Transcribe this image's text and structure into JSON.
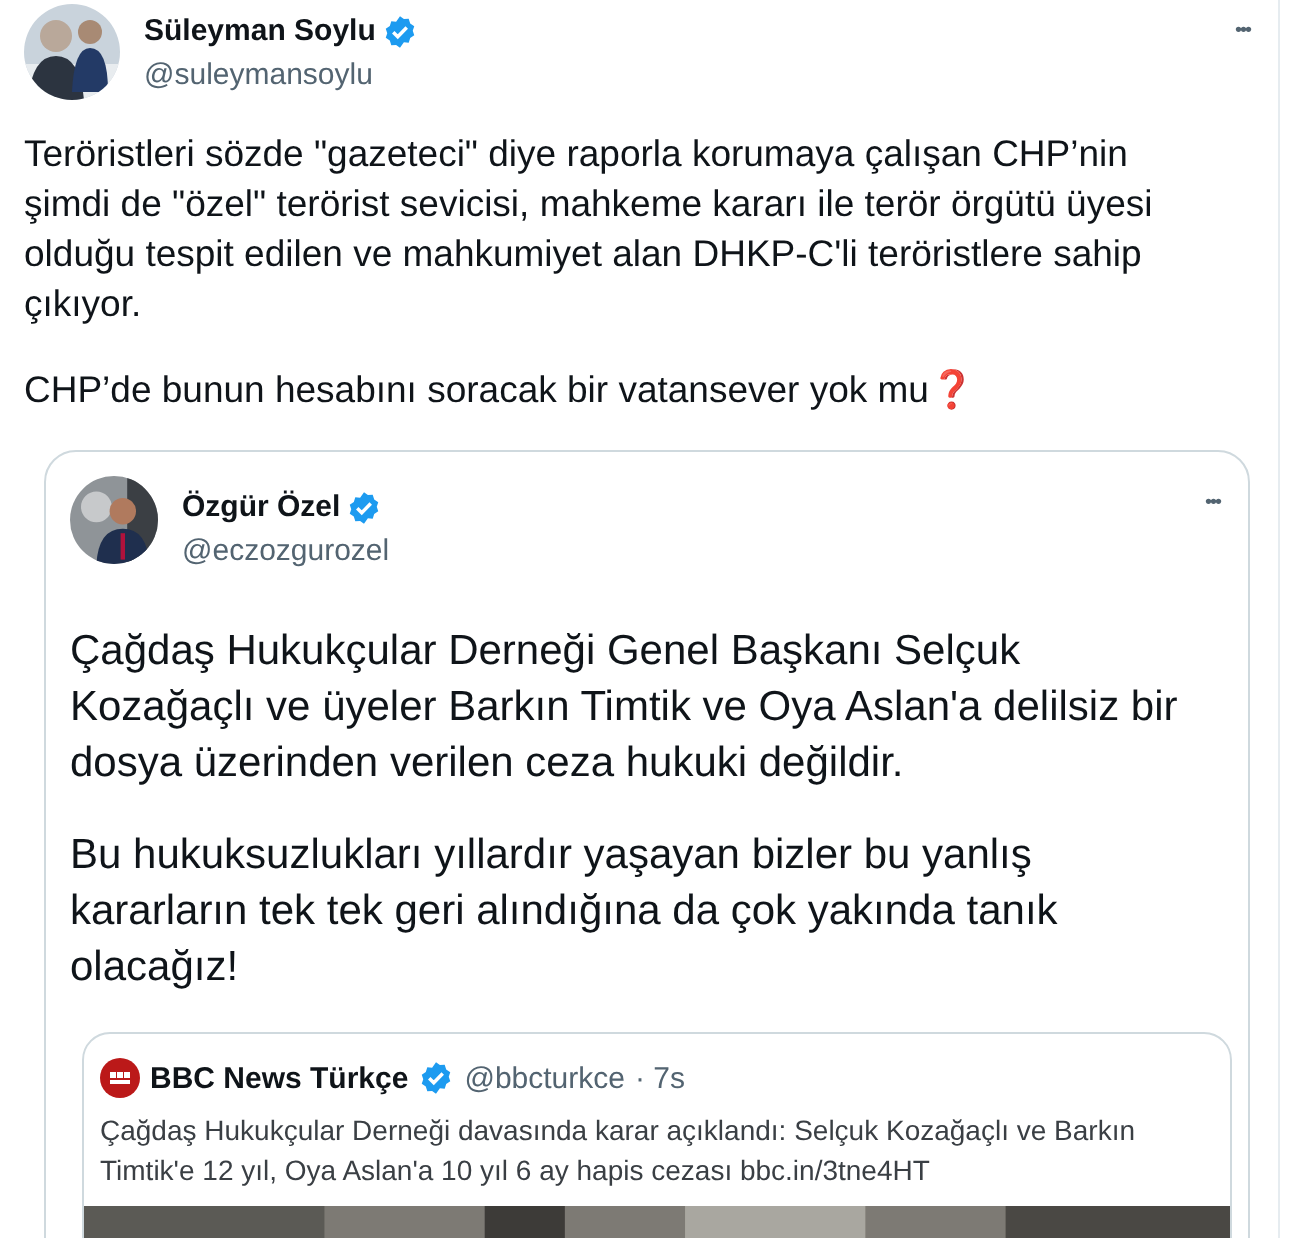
{
  "tweet": {
    "author": {
      "name": "Süleyman Soylu",
      "handle": "@suleymansoylu",
      "verified": true
    },
    "more": "•••",
    "paragraphs": [
      "Teröristleri sözde \"gazeteci\" diye raporla korumaya çalışan CHP’nin şimdi de \"özel\" terörist sevicisi, mahkeme kararı ile terör örgütü üyesi olduğu tespit edilen ve mahkumiyet alan DHKP-C'li teröristlere sahip çıkıyor.",
      "CHP’de bunun hesabını soracak bir vatansever yok mu❓"
    ],
    "quote": {
      "author": {
        "name": "Özgür Özel",
        "handle": "@eczozgurozel",
        "verified": true
      },
      "more": "•••",
      "paragraphs": [
        "Çağdaş Hukukçular Derneği Genel Başkanı Selçuk Kozağaçlı ve üyeler Barkın Timtik ve Oya Aslan'a delilsiz bir dosya üzerinden verilen ceza hukuki değildir.",
        "Bu hukuksuzlukları yıllardır yaşayan bizler bu yanlış kararların tek tek geri alındığına da çok yakında tanık olacağız!"
      ],
      "quote": {
        "author": {
          "name": "BBC News Türkçe",
          "handle": "@bbcturkce",
          "verified": true
        },
        "time": "· 7s",
        "text": "Çağdaş Hukukçular Derneği davasında karar açıklandı: Selçuk Kozağaçlı ve Barkın Timtik'e 12 yıl, Oya Aslan'a 10 yıl 6 ay hapis cezası bbc.in/3tne4HT"
      }
    }
  }
}
